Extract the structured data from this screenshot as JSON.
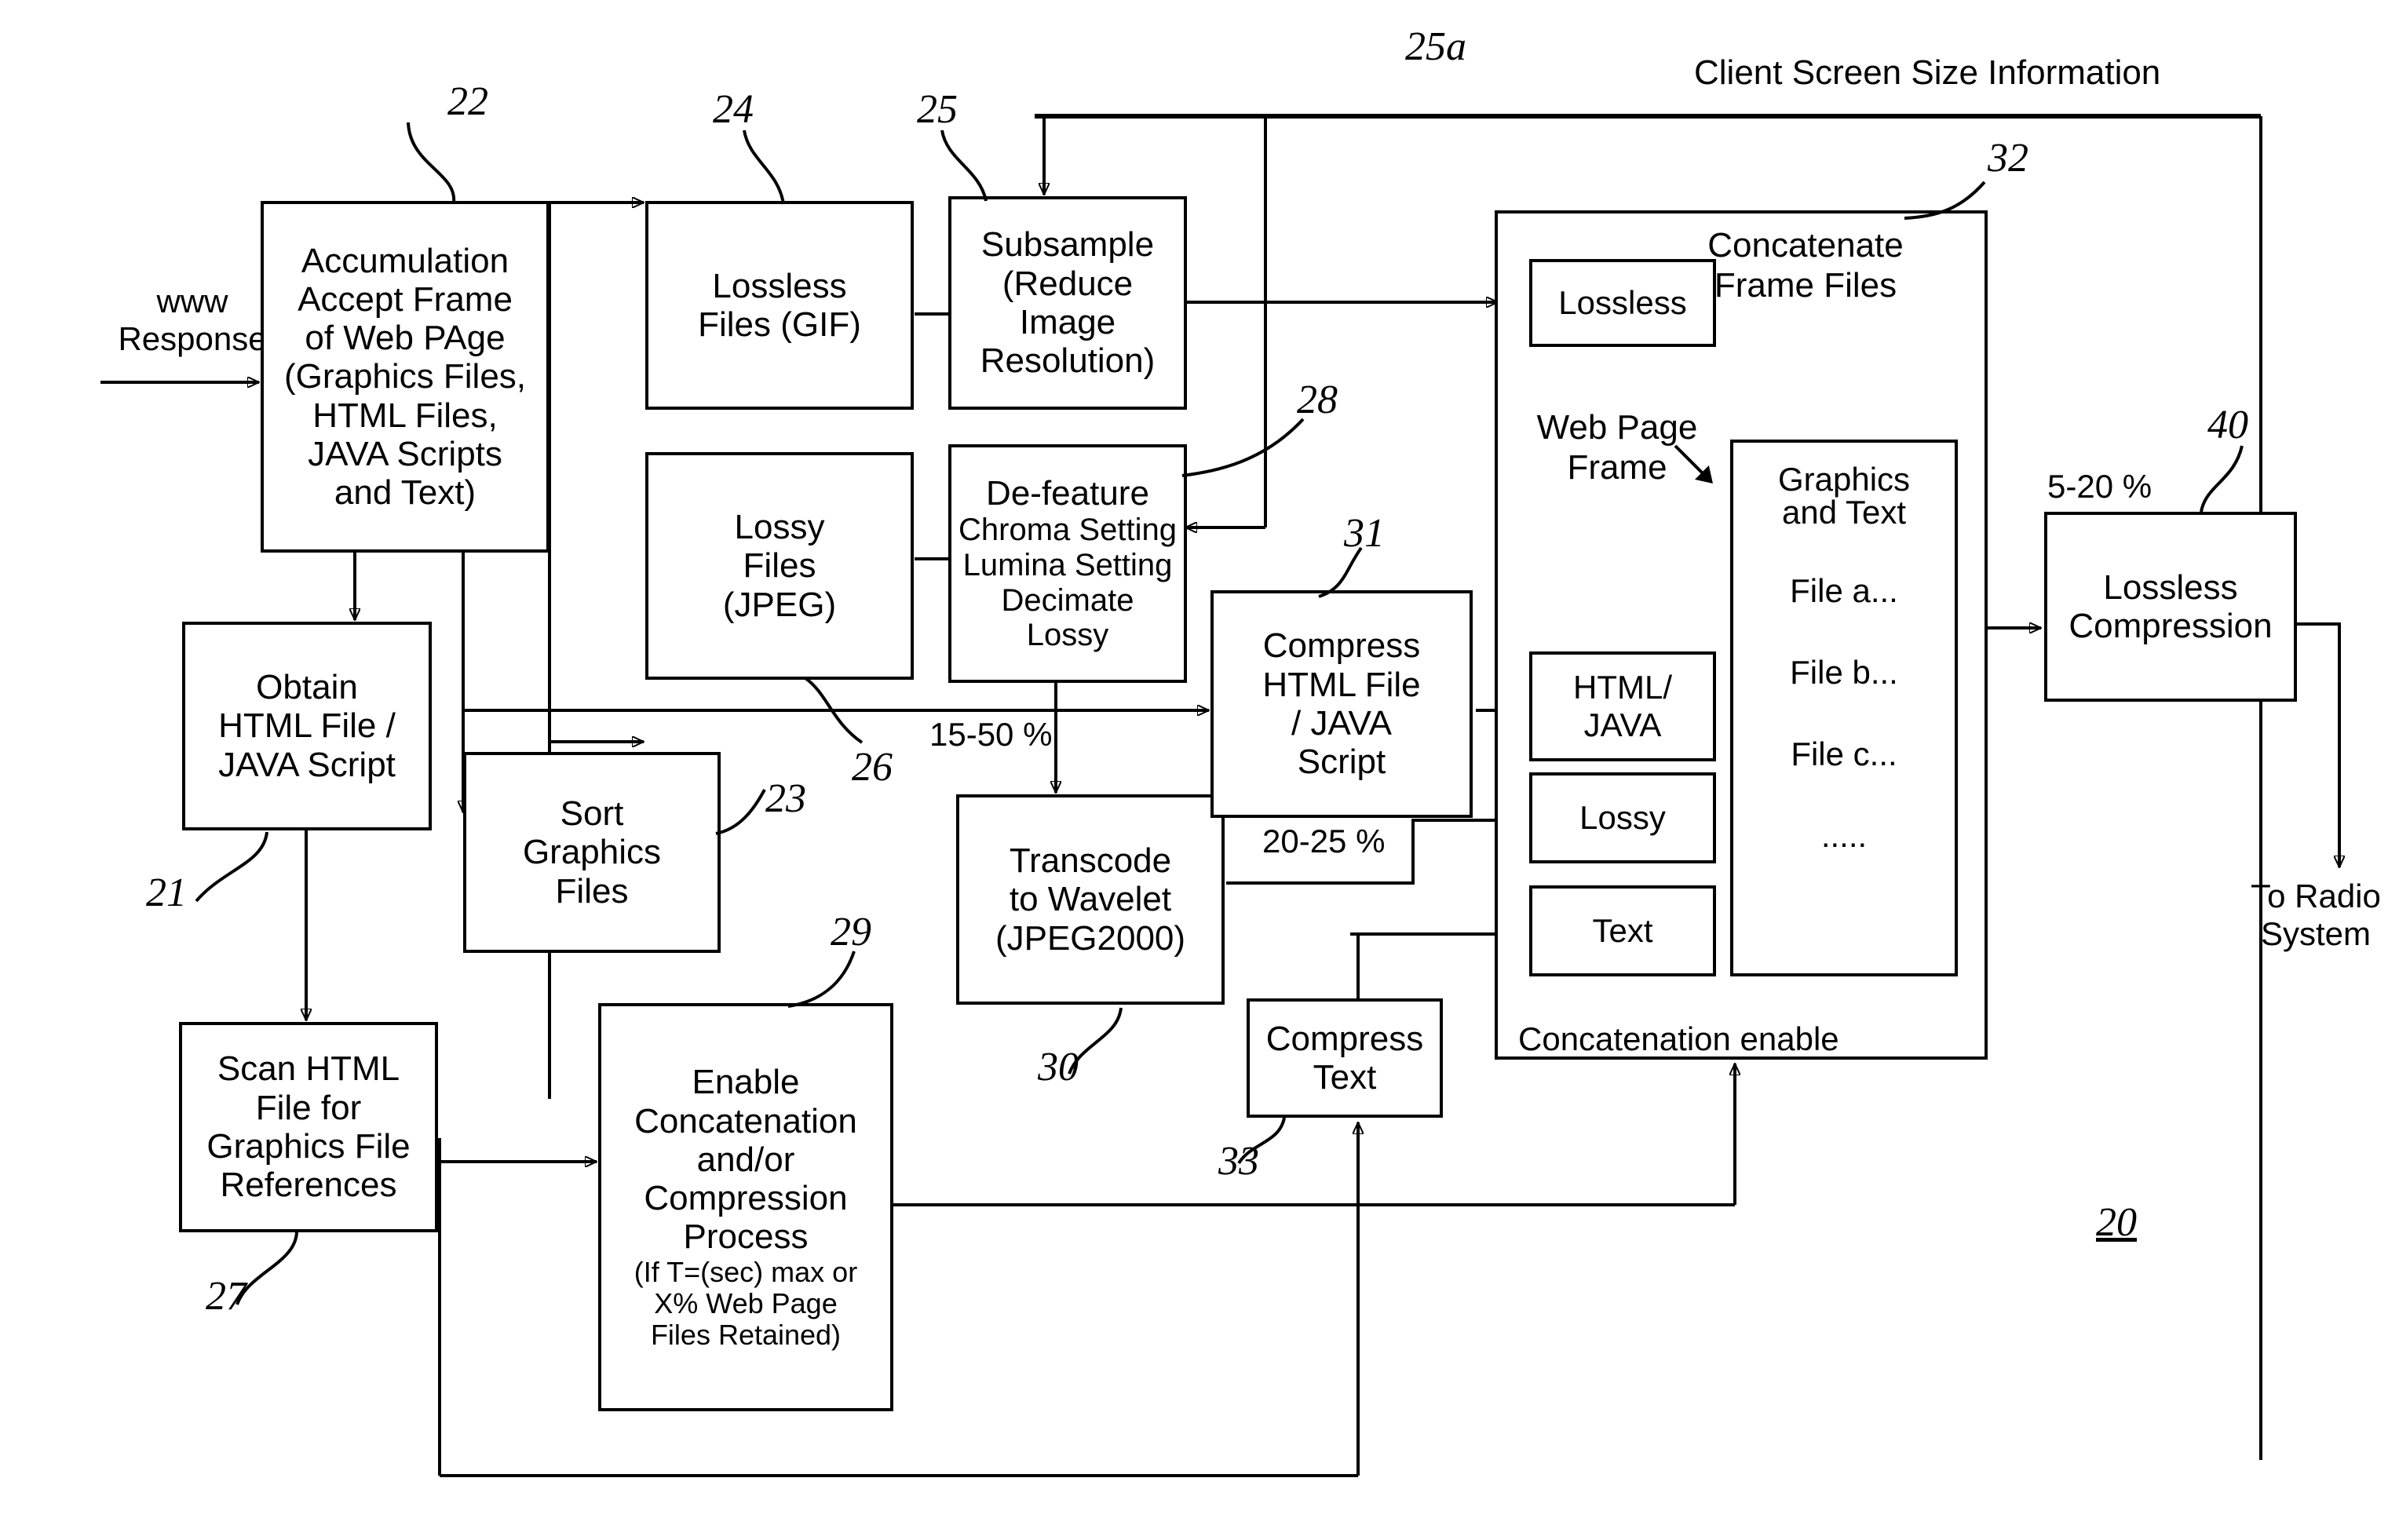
{
  "figure": {
    "header_label": "Client Screen Size Information",
    "figure_number": "20"
  },
  "blocks": {
    "accumulation": {
      "ref": "22",
      "lines": [
        "Accumulation",
        "Accept Frame",
        "of Web PAge",
        "(Graphics Files,",
        "HTML Files,",
        "JAVA Scripts",
        "and Text)"
      ]
    },
    "lossless_files": {
      "ref": "24",
      "lines": [
        "Lossless",
        "Files (GIF)"
      ]
    },
    "lossy_files": {
      "ref": "26",
      "lines": [
        "Lossy",
        "Files",
        "(JPEG)"
      ]
    },
    "subsample": {
      "ref": "25",
      "lines": [
        "Subsample",
        "(Reduce",
        "Image",
        "Resolution)"
      ]
    },
    "defeature": {
      "ref": "28",
      "lines": [
        "De-feature",
        "Chroma Setting",
        "Lumina Setting",
        "Decimate",
        "Lossy"
      ]
    },
    "obtain_html": {
      "ref": "21",
      "lines": [
        "Obtain",
        "HTML File /",
        "JAVA Script"
      ]
    },
    "sort_graphics": {
      "ref": "23",
      "lines": [
        "Sort",
        "Graphics",
        "Files"
      ]
    },
    "scan_html": {
      "ref": "27",
      "lines": [
        "Scan HTML",
        "File for",
        "Graphics File",
        "References"
      ]
    },
    "enable_concat": {
      "ref": "29",
      "lines": [
        "Enable",
        "Concatenation",
        "and/or",
        "Compression",
        "Process"
      ],
      "sublines": [
        "(If T=(sec) max or",
        "X% Web Page",
        "Files Retained)"
      ]
    },
    "transcode": {
      "ref": "30",
      "lines": [
        "Transcode",
        "to Wavelet",
        "(JPEG2000)"
      ]
    },
    "compress_html": {
      "ref": "31",
      "lines": [
        "Compress",
        "HTML File",
        "/ JAVA",
        "Script"
      ]
    },
    "compress_text": {
      "ref": "33",
      "lines": [
        "Compress",
        "Text"
      ]
    },
    "concatenate": {
      "ref": "32",
      "title_lines": [
        "Concatenate",
        "Frame Files"
      ],
      "web_page_frame": [
        "Web Page",
        "Frame"
      ],
      "footer": "Concatenation enable",
      "slots": [
        "Lossless",
        "HTML/ JAVA",
        "Lossy",
        "Text"
      ],
      "slot_lossless": [
        "Lossless"
      ],
      "slot_htmljava": [
        "HTML/",
        "JAVA"
      ],
      "slot_lossy": [
        "Lossy"
      ],
      "slot_text": [
        "Text"
      ],
      "file_list_header": [
        "Graphics",
        "and Text"
      ],
      "file_list": [
        "File a...",
        "File b...",
        "File c...",
        "....."
      ]
    },
    "lossless_compression": {
      "ref": "40",
      "lines": [
        "Lossless",
        "Compression"
      ]
    }
  },
  "annotations": {
    "www_response": [
      "www",
      "Response"
    ],
    "pct_15_50": "15-50 %",
    "pct_20_25": "20-25 %",
    "pct_5_20": "5-20 %",
    "to_radio": [
      "To Radio",
      "System"
    ],
    "ref_25a": "25a"
  }
}
